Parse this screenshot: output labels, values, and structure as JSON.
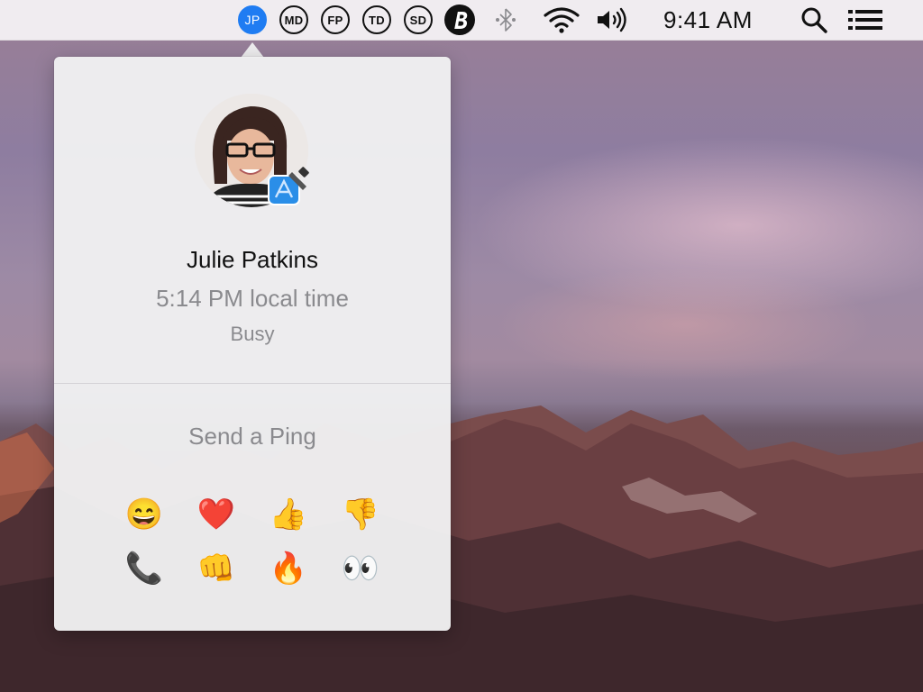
{
  "menubar": {
    "user_badges": [
      {
        "initials": "JP",
        "active": true
      },
      {
        "initials": "MD",
        "active": false
      },
      {
        "initials": "FP",
        "active": false
      },
      {
        "initials": "TD",
        "active": false
      },
      {
        "initials": "SD",
        "active": false
      }
    ],
    "clock": "9:41 AM",
    "icons": [
      "app-b-icon",
      "bluetooth-icon",
      "wifi-icon",
      "volume-icon",
      "search-icon",
      "notification-list-icon"
    ]
  },
  "popover": {
    "name": "Julie Patkins",
    "local_time": "5:14 PM local time",
    "status": "Busy",
    "ping_title": "Send a Ping",
    "pings": [
      "😄",
      "❤️",
      "👍",
      "👎",
      "📞",
      "👊",
      "🔥",
      "👀"
    ],
    "ping_names": [
      "grinning-face-emoji",
      "heart-emoji",
      "thumbs-up-emoji",
      "thumbs-down-emoji",
      "telephone-emoji",
      "fist-bump-emoji",
      "fire-emoji",
      "eyes-emoji"
    ]
  },
  "colors": {
    "accent": "#1f7cf2",
    "secondary_text": "#8a8a8e"
  }
}
